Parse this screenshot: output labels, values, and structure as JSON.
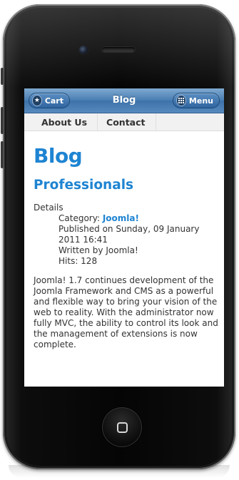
{
  "header": {
    "cart_label": "Cart",
    "title": "Blog",
    "menu_label": "Menu"
  },
  "nav": {
    "items": [
      {
        "label": "About Us"
      },
      {
        "label": "Contact"
      }
    ]
  },
  "page": {
    "title": "Blog",
    "article_title": "Professionals"
  },
  "details": {
    "heading": "Details",
    "category_prefix": "Category: ",
    "category_value": "Joomla!",
    "published": "Published on Sunday, 09 January 2011 16:41",
    "written_by": "Written by Joomla!",
    "hits": "Hits: 128"
  },
  "article": {
    "body": "Joomla! 1.7 continues development of the Joomla Framework and CMS as a powerful and flexible way to bring your vision of the web to reality. With the administrator now fully MVC, the ability to control its look and the management of extensions is now complete."
  },
  "colors": {
    "accent": "#1e84d2",
    "topbar": "#4a7fb4"
  },
  "icons": {
    "cart": "star-icon",
    "menu": "grid-icon",
    "home": "home-square-icon"
  }
}
